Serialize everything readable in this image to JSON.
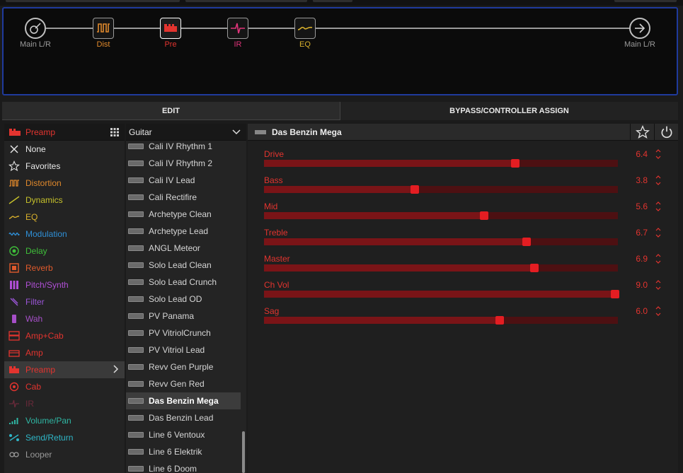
{
  "signal_chain": {
    "nodes": [
      {
        "label": "Main L/R",
        "icon": "guitar-input-icon",
        "color": "#9a9a9a"
      },
      {
        "label": "Dist",
        "icon": "distortion-icon",
        "color": "#e0892c"
      },
      {
        "label": "Pre",
        "icon": "preamp-icon",
        "color": "#e3342f"
      },
      {
        "label": "IR",
        "icon": "ir-icon",
        "color": "#e0347a"
      },
      {
        "label": "EQ",
        "icon": "eq-icon",
        "color": "#d8b02c"
      },
      {
        "label": "Main L/R",
        "icon": "output-arrow-icon",
        "color": "#9a9a9a"
      }
    ]
  },
  "tabs": {
    "edit": "EDIT",
    "bypass": "BYPASS/CONTROLLER ASSIGN"
  },
  "categories": {
    "header": "Preamp",
    "items": [
      {
        "label": "None",
        "color": "#e8e8e8",
        "icon": "none-x-icon"
      },
      {
        "label": "Favorites",
        "color": "#e8e8e8",
        "icon": "star-icon"
      },
      {
        "label": "Distortion",
        "color": "#e0892c",
        "icon": "distortion-icon"
      },
      {
        "label": "Dynamics",
        "color": "#c7c22b",
        "icon": "dynamics-icon"
      },
      {
        "label": "EQ",
        "color": "#d8b02c",
        "icon": "eq-icon"
      },
      {
        "label": "Modulation",
        "color": "#2f8fd6",
        "icon": "modulation-icon"
      },
      {
        "label": "Delay",
        "color": "#3fbf3a",
        "icon": "delay-icon"
      },
      {
        "label": "Reverb",
        "color": "#e05a2c",
        "icon": "reverb-icon"
      },
      {
        "label": "Pitch/Synth",
        "color": "#b04fd6",
        "icon": "pitch-synth-icon"
      },
      {
        "label": "Filter",
        "color": "#9a55d6",
        "icon": "filter-icon"
      },
      {
        "label": "Wah",
        "color": "#a64fc8",
        "icon": "wah-icon"
      },
      {
        "label": "Amp+Cab",
        "color": "#e3342f",
        "icon": "amp-cab-icon"
      },
      {
        "label": "Amp",
        "color": "#e3342f",
        "icon": "amp-icon"
      },
      {
        "label": "Preamp",
        "color": "#e3342f",
        "icon": "preamp-icon",
        "active": true
      },
      {
        "label": "Cab",
        "color": "#e3342f",
        "icon": "cab-icon"
      },
      {
        "label": "IR",
        "color": "#6a2a3a",
        "icon": "ir-icon"
      },
      {
        "label": "Volume/Pan",
        "color": "#2fb7a4",
        "icon": "volume-pan-icon"
      },
      {
        "label": "Send/Return",
        "color": "#2fb7c8",
        "icon": "send-return-icon"
      },
      {
        "label": "Looper",
        "color": "#9a9a9a",
        "icon": "looper-icon"
      }
    ]
  },
  "models": {
    "header": "Guitar",
    "items": [
      "Cali IV Rhythm 1",
      "Cali IV Rhythm 2",
      "Cali IV Lead",
      "Cali Rectifire",
      "Archetype Clean",
      "Archetype Lead",
      "ANGL Meteor",
      "Solo Lead Clean",
      "Solo Lead Crunch",
      "Solo Lead OD",
      "PV Panama",
      "PV VitriolCrunch",
      "PV Vitriol Lead",
      "Revv Gen Purple",
      "Revv Gen Red",
      "Das Benzin Mega",
      "Das Benzin Lead",
      "Line 6 Ventoux",
      "Line 6 Elektrik",
      "Line 6 Doom"
    ],
    "selected": "Das Benzin Mega"
  },
  "params_panel": {
    "title": "Das Benzin Mega",
    "params": [
      {
        "name": "Drive",
        "value": "6.4",
        "level": 0.71
      },
      {
        "name": "Bass",
        "value": "3.8",
        "level": 0.426
      },
      {
        "name": "Mid",
        "value": "5.6",
        "level": 0.622
      },
      {
        "name": "Treble",
        "value": "6.7",
        "level": 0.742
      },
      {
        "name": "Master",
        "value": "6.9",
        "level": 0.764
      },
      {
        "name": "Ch Vol",
        "value": "9.0",
        "level": 0.992
      },
      {
        "name": "Sag",
        "value": "6.0",
        "level": 0.666
      }
    ]
  }
}
